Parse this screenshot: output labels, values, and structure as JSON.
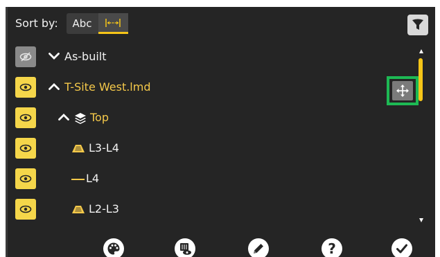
{
  "toolbar": {
    "sort_label": "Sort by:",
    "sort_alpha_label": "Abc",
    "sort_distance_icon": "distance-icon",
    "filter_icon": "filter-icon",
    "active_accent": "#f5c518"
  },
  "tree": {
    "rows": [
      {
        "label": "As-built",
        "visible": false,
        "expanded": true,
        "color": "white",
        "icon": "chevron-down-icon"
      },
      {
        "label": "T-Site West.lmd",
        "visible": true,
        "expanded": false,
        "color": "yellow",
        "icon": "chevron-up-icon"
      },
      {
        "label": "Top",
        "visible": true,
        "expanded": false,
        "color": "yellow",
        "icon": "layers-icon"
      },
      {
        "label": "L3-L4",
        "visible": true,
        "color": "white",
        "icon": "surface-icon"
      },
      {
        "label": "L4",
        "visible": true,
        "color": "white",
        "icon": "line-icon"
      },
      {
        "label": "L2-L3",
        "visible": true,
        "color": "white",
        "icon": "surface-icon"
      }
    ]
  },
  "side": {
    "move_icon": "move-icon",
    "highlight_color": "#1db954"
  },
  "bottom_bar": {
    "buttons": [
      {
        "icon": "palette-icon"
      },
      {
        "icon": "layer-visibility-icon"
      },
      {
        "icon": "pencil-icon"
      },
      {
        "icon": "help-icon",
        "label": "?"
      },
      {
        "icon": "checkmark-icon"
      }
    ]
  }
}
